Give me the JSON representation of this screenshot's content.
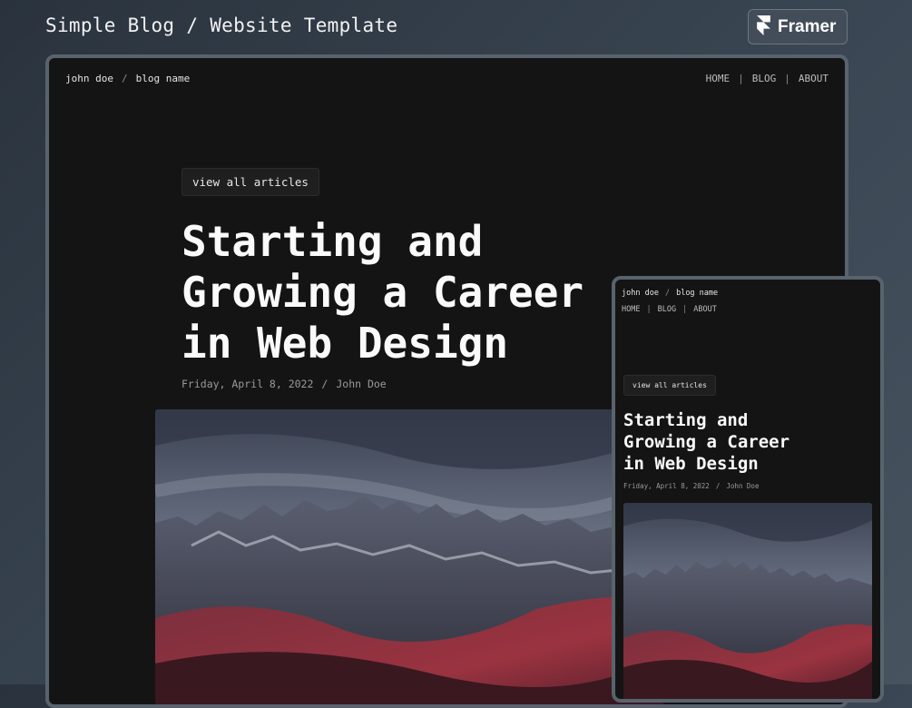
{
  "page": {
    "title": "Simple Blog / Website Template"
  },
  "brand": {
    "icon": "framer-logo-icon",
    "label": "Framer"
  },
  "site": {
    "author": "john doe",
    "blog_name": "blog name",
    "breadcrumb_separator": "/",
    "nav": {
      "home": "HOME",
      "blog": "BLOG",
      "about": "ABOUT",
      "separator": "|"
    }
  },
  "article": {
    "view_all_label": "view all articles",
    "title_lines": [
      "Starting and",
      "Growing a Career",
      "in Web Design"
    ],
    "date": "Friday, April 8, 2022",
    "meta_separator": "/",
    "author": "John Doe",
    "hero_image": "mountain-landscape-image"
  },
  "colors": {
    "background": "#3a4653",
    "frame_bg": "#141414",
    "frame_border": "#59636e",
    "text": "#fafafa",
    "muted": "#9a9a9a"
  }
}
